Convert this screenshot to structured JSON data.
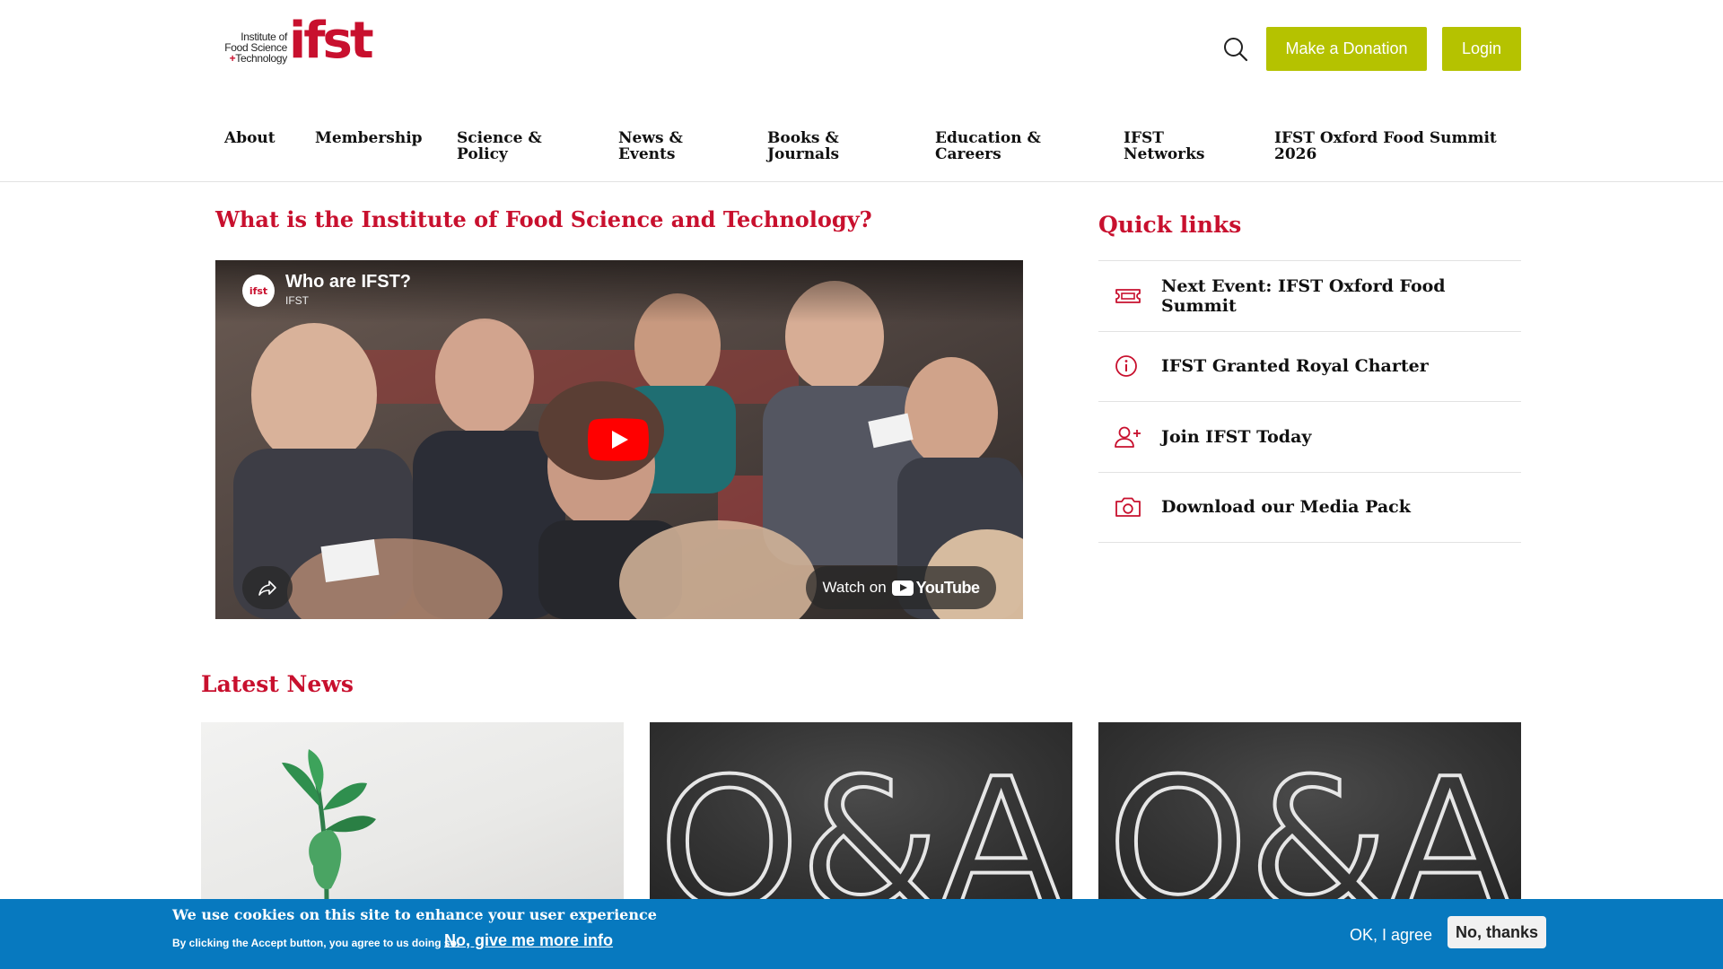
{
  "brand": {
    "logo_line1": "Institute of",
    "logo_line2": "Food Science",
    "logo_plus": "+",
    "logo_line3": "Technology",
    "logo_word": "ifst"
  },
  "header": {
    "donate_label": "Make a Donation",
    "login_label": "Login",
    "search_icon": "search-icon"
  },
  "nav": {
    "items": [
      {
        "label": "About"
      },
      {
        "label": "Membership"
      },
      {
        "label": "Science & Policy"
      },
      {
        "label": "News & Events"
      },
      {
        "label": "Books & Journals"
      },
      {
        "label": "Education & Careers"
      },
      {
        "label": "IFST Networks"
      },
      {
        "label": "IFST Oxford Food Summit 2026"
      }
    ]
  },
  "main": {
    "heading": "What is the Institute of Food Science and Technology?",
    "video": {
      "title": "Who are IFST?",
      "channel": "IFST",
      "badge_text": "ifst",
      "watch_on": "Watch on",
      "platform": "YouTube"
    }
  },
  "quick_links": {
    "heading": "Quick links",
    "items": [
      {
        "label": "Next Event: IFST Oxford Food Summit",
        "icon": "ticket-icon"
      },
      {
        "label": "IFST Granted Royal Charter",
        "icon": "info-icon"
      },
      {
        "label": "Join IFST Today",
        "icon": "add-user-icon"
      },
      {
        "label": "Download our Media Pack",
        "icon": "camera-icon"
      }
    ]
  },
  "news": {
    "heading": "Latest News",
    "cards": [
      {
        "image": "plant-sprout-image"
      },
      {
        "image": "qa-chalkboard-image",
        "image_text": "Q&A"
      },
      {
        "image": "qa-chalkboard-image",
        "image_text": "Q&A"
      }
    ]
  },
  "cookie": {
    "title": "We use cookies on this site to enhance your user experience",
    "text": "By clicking the Accept button, you agree to us doing so.",
    "more_info": "No, give me more info",
    "ok_label": "OK, I agree",
    "no_label": "No, thanks"
  },
  "colors": {
    "brand_red": "#c8102e",
    "button_green": "#b5c200",
    "cookie_blue": "#0779bf"
  }
}
